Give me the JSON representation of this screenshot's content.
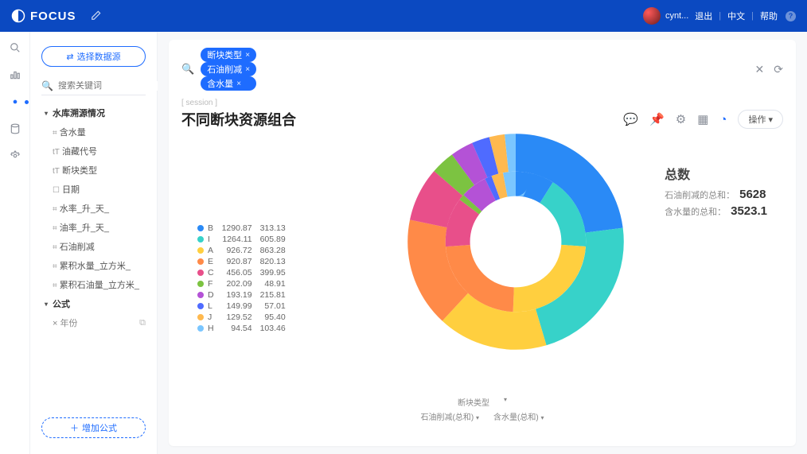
{
  "app": {
    "name": "FOCUS"
  },
  "topbar": {
    "username": "cynt...",
    "logout": "退出",
    "lang": "中文",
    "help": "帮助"
  },
  "sidebar": {
    "select_ds": "选择数据源",
    "search_ph": "搜索关键词",
    "sections": [
      {
        "name": "水库溯源情况",
        "items": [
          {
            "icon": "⌗",
            "label": "含水量"
          },
          {
            "icon": "tT",
            "label": "油藏代号"
          },
          {
            "icon": "tT",
            "label": "断块类型"
          },
          {
            "icon": "☐",
            "label": "日期"
          },
          {
            "icon": "⌗",
            "label": "水率_升_天_"
          },
          {
            "icon": "⌗",
            "label": "油率_升_天_"
          },
          {
            "icon": "⌗",
            "label": "石油削减"
          },
          {
            "icon": "⌗",
            "label": "累积水量_立方米_"
          },
          {
            "icon": "⌗",
            "label": "累积石油量_立方米_"
          }
        ]
      },
      {
        "name": "公式",
        "items": [
          {
            "icon": "×",
            "label": "年份",
            "del": true
          }
        ]
      }
    ],
    "add_formula": "增加公式"
  },
  "query": {
    "chips": [
      "断块类型",
      "石油削减",
      "含水量"
    ],
    "crumb": "[ session ]",
    "title": "不同断块资源组合",
    "op": "操作"
  },
  "totals": {
    "head": "总数",
    "rows": [
      {
        "label": "石油削减的总和：",
        "value": "5628"
      },
      {
        "label": "含水量的总和：",
        "value": "3523.1"
      }
    ]
  },
  "footer": {
    "row1": "断块类型",
    "row2a": "石油削减(总和)",
    "row2b": "含水量(总和)"
  },
  "chart_data": {
    "type": "pie",
    "title": "不同断块资源组合",
    "series_names": [
      "石油削减(总和)",
      "含水量(总和)"
    ],
    "categories": [
      "B",
      "I",
      "A",
      "E",
      "C",
      "F",
      "D",
      "L",
      "J",
      "H"
    ],
    "colors": [
      "#2a8af6",
      "#37d2c9",
      "#ffcf3f",
      "#ff8a48",
      "#e84f8a",
      "#7cc341",
      "#b452d6",
      "#4f6bff",
      "#ffb94f",
      "#7ac6ff"
    ],
    "series": [
      {
        "name": "石油削减(总和)",
        "values": [
          1290.87,
          1264.11,
          926.72,
          920.87,
          456.05,
          202.09,
          193.19,
          149.99,
          129.52,
          94.54
        ]
      },
      {
        "name": "含水量(总和)",
        "values": [
          313.13,
          605.89,
          863.28,
          820.13,
          399.95,
          48.91,
          215.81,
          57.01,
          95.4,
          103.46
        ]
      }
    ]
  }
}
